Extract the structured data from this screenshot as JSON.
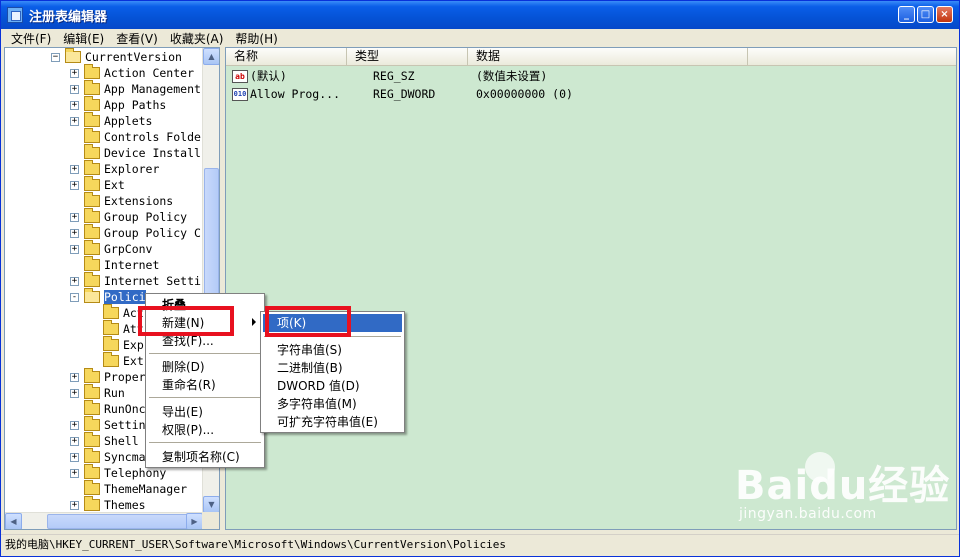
{
  "window": {
    "title": "注册表编辑器",
    "buttons": {
      "minimize": "_",
      "maximize": "□",
      "close": "×"
    }
  },
  "menubar": [
    "文件(F)",
    "编辑(E)",
    "查看(V)",
    "收藏夹(A)",
    "帮助(H)"
  ],
  "tree": {
    "root": "CurrentVersion",
    "items": [
      {
        "label": "Action Center",
        "expander": "+"
      },
      {
        "label": "App Management",
        "expander": "+"
      },
      {
        "label": "App Paths",
        "expander": "+"
      },
      {
        "label": "Applets",
        "expander": "+"
      },
      {
        "label": "Controls Folde",
        "expander": ""
      },
      {
        "label": "Device Install",
        "expander": ""
      },
      {
        "label": "Explorer",
        "expander": "+"
      },
      {
        "label": "Ext",
        "expander": "+"
      },
      {
        "label": "Extensions",
        "expander": ""
      },
      {
        "label": "Group Policy",
        "expander": "+"
      },
      {
        "label": "Group Policy C",
        "expander": "+"
      },
      {
        "label": "GrpConv",
        "expander": "+"
      },
      {
        "label": "Internet",
        "expander": ""
      },
      {
        "label": "Internet Setti",
        "expander": "+"
      },
      {
        "label": "Polici",
        "expander": "-"
      }
    ],
    "children": [
      "Act",
      "Att",
      "Exp",
      "Ext"
    ],
    "after": [
      {
        "label": "Proper",
        "expander": "+"
      },
      {
        "label": "Run",
        "expander": "+"
      },
      {
        "label": "RunOnc",
        "expander": ""
      },
      {
        "label": "Settin",
        "expander": "+"
      },
      {
        "label": "Shell",
        "expander": "+"
      },
      {
        "label": "Syncma",
        "expander": "+"
      },
      {
        "label": "Telephony",
        "expander": "+"
      },
      {
        "label": "ThemeManager",
        "expander": ""
      },
      {
        "label": "Themes",
        "expander": "+"
      }
    ]
  },
  "list": {
    "columns": [
      "名称",
      "类型",
      "数据"
    ],
    "rows": [
      {
        "icon": "ab",
        "name": "(默认)",
        "type": "REG_SZ",
        "data": "(数值未设置)"
      },
      {
        "icon": "010",
        "name": "Allow Prog...",
        "type": "REG_DWORD",
        "data": "0x00000000 (0)"
      }
    ]
  },
  "context_menu": {
    "items": [
      "折叠",
      "新建(N)",
      "查找(F)...",
      "删除(D)",
      "重命名(R)",
      "导出(E)",
      "权限(P)...",
      "复制项名称(C)"
    ]
  },
  "submenu": {
    "items": [
      "项(K)",
      "字符串值(S)",
      "二进制值(B)",
      "DWORD 值(D)",
      "多字符串值(M)",
      "可扩充字符串值(E)"
    ]
  },
  "statusbar": "我的电脑\\HKEY_CURRENT_USER\\Software\\Microsoft\\Windows\\CurrentVersion\\Policies",
  "watermark": {
    "logo": "Baidu经验",
    "url": "jingyan.baidu.com"
  }
}
